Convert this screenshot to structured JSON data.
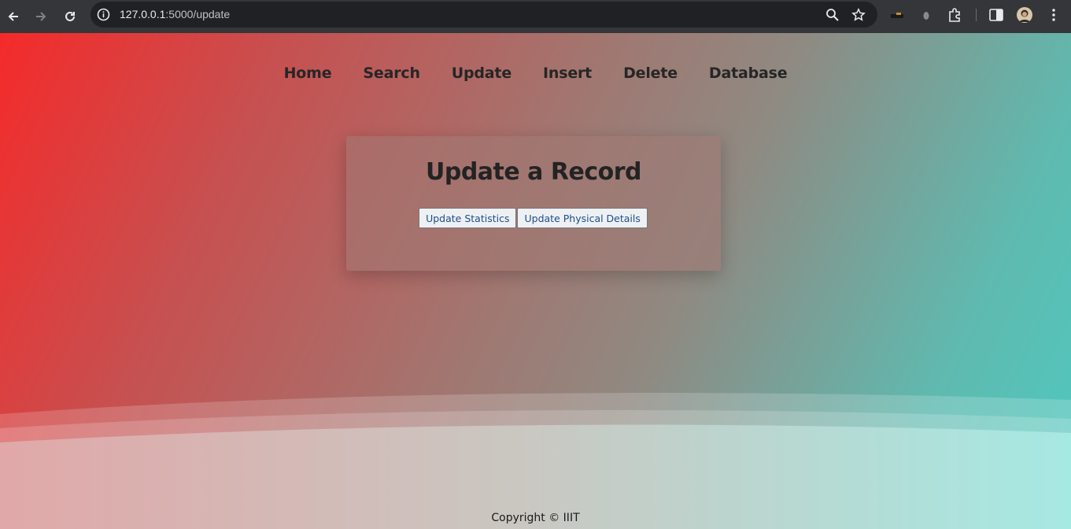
{
  "browser": {
    "url_host": "127.0.0.1",
    "url_path": ":5000/update"
  },
  "nav": {
    "items": [
      "Home",
      "Search",
      "Update",
      "Insert",
      "Delete",
      "Database"
    ]
  },
  "card": {
    "title": "Update a Record",
    "buttons": [
      "Update Statistics",
      "Update Physical Details"
    ]
  },
  "footer": {
    "text": "Copyright © IIIT"
  },
  "colors": {
    "gradient_start": "#f52a2a",
    "gradient_end": "#4ec9bf",
    "text": "#262626",
    "button_text": "#1c4f8a"
  }
}
